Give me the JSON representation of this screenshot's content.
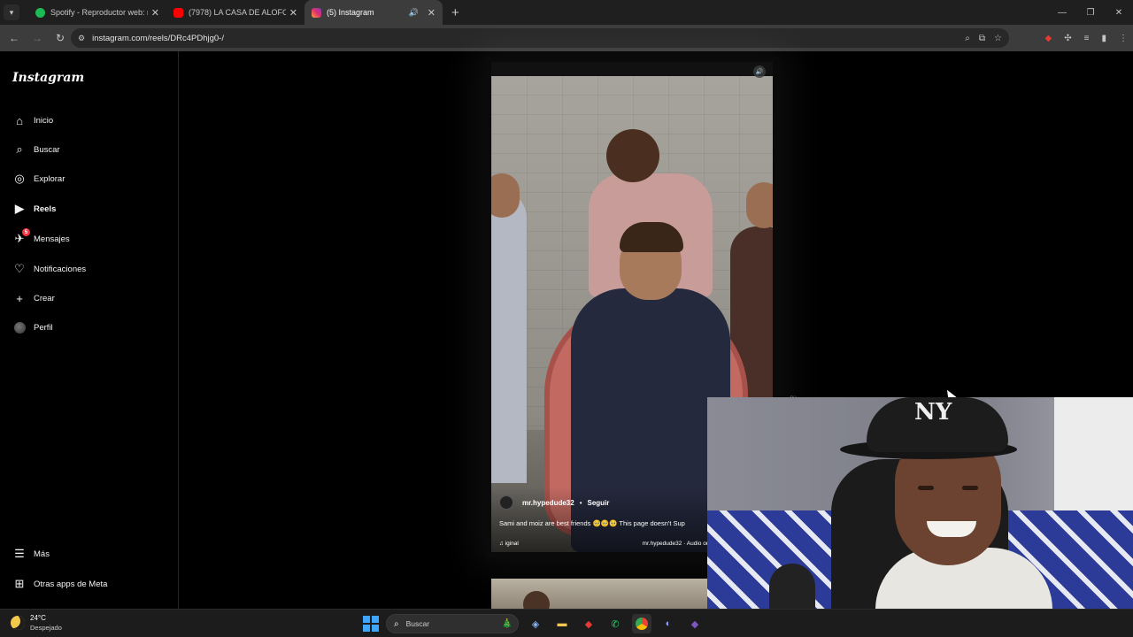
{
  "browser": {
    "tabs": [
      {
        "title": "Spotify - Reproductor web: mú",
        "favicon_color": "#1db954",
        "active": false
      },
      {
        "title": "(7978) LA CASA DE ALOFOKE 2",
        "favicon_color": "#ff0000",
        "active": false
      },
      {
        "title": "(5) Instagram",
        "favicon_color": "#e1306c",
        "active": true
      }
    ],
    "url": "instagram.com/reels/DRc4PDhjg0-/"
  },
  "instagram": {
    "logo": "Instagram",
    "nav": [
      {
        "label": "Inicio",
        "icon": "home-icon"
      },
      {
        "label": "Buscar",
        "icon": "search-icon"
      },
      {
        "label": "Explorar",
        "icon": "compass-icon"
      },
      {
        "label": "Reels",
        "icon": "reels-icon"
      },
      {
        "label": "Mensajes",
        "icon": "messenger-icon",
        "badge": "5"
      },
      {
        "label": "Notificaciones",
        "icon": "heart-icon"
      },
      {
        "label": "Crear",
        "icon": "plus-icon"
      },
      {
        "label": "Perfil",
        "icon": "avatar"
      }
    ],
    "more": [
      {
        "label": "Más",
        "icon": "menu-icon"
      },
      {
        "label": "Otras apps de Meta",
        "icon": "apps-icon"
      }
    ],
    "reel": {
      "username": "mr.hypedude32",
      "separator": "•",
      "follow": "Seguir",
      "caption": "Sami and moiz are best friends 🥺🥺🥺 This page doesn't Sup",
      "audio_left": "iginal",
      "audio_right": "mr.hypedude32 · Audio or"
    }
  },
  "taskbar": {
    "temperature": "24°C",
    "condition": "Despejado",
    "search_placeholder": "Buscar"
  },
  "colors": {
    "background": "#000000",
    "chrome_tabstrip": "#1f1f1f",
    "chrome_toolbar": "#3c3c3c",
    "badge": "#ff3040"
  }
}
